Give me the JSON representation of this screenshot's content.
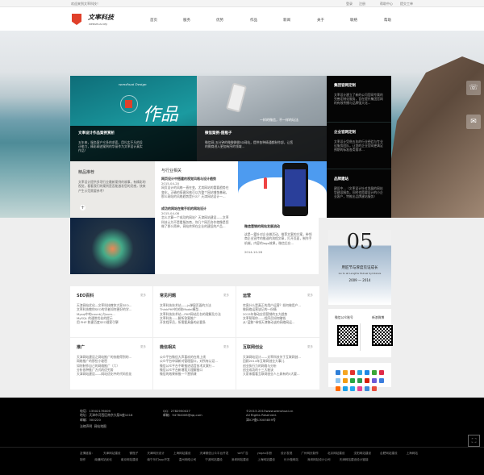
{
  "topbar": {
    "welcome": "欢迎来到文率科技！",
    "login": "登录",
    "register": "注册",
    "help": "帮助中心",
    "ticket": "提交工单"
  },
  "logo": {
    "name": "文率科技",
    "sub": "WENSHUAI KEJI"
  },
  "nav": [
    "首页",
    "服务",
    "优势",
    "作品",
    "新闻",
    "关于",
    "联络",
    "帮助"
  ],
  "hero": {
    "card1": {
      "brand": "wenshuai Design",
      "big": "作品",
      "title": "文率设计作品案例赏析",
      "desc": "五年来，服务客户众多的求索。用扎实不凡的设计能力，精彩阐述案例的华丽作为文率设计真实作品！"
    },
    "card2": {
      "tagline": "一样的微信，不一样的玩法",
      "title": "微信案例-甜瓶子",
      "desc": "微信网-五分钟的微微微微3D网站，提供各种精通都制作部，让您的微商进入更加有序的领域..."
    },
    "side": [
      {
        "title": "集团官网定制",
        "desc": "文率设计建立了新的公司官网专属的完善定制化服务，旨在提升集团官网的有效传播与品牌强大化..."
      },
      {
        "title": "企业官网定制",
        "desc": "文率设计凭借五年的行业经验与专业化服务团队，让您的企业官网更满足预期的标准各类需求..."
      },
      {
        "title": "品牌建站",
        "desc": "建设中...（文率设计针对发展的网站型建设服务，同时也简要设计的小企业客户，特推出品牌建站服务）"
      }
    ]
  },
  "feature": {
    "title": "精品推荐",
    "desc": "文率设计提供多项行业最新案例的故事，有精彩的视觉，看看我们的案例是否能激发您的灵感，快来产生示范需要参考！"
  },
  "industry": {
    "title": "与行业相关",
    "news": [
      {
        "title": "网页设计中搭建的视觉风格与设计趋势",
        "date": "2015-04-20",
        "desc": "网页设计的风格一直在变，尤其网站的重要趋势在变化，正确的搭建风格可以为整个网站铺垫基础，那么网站的风格趋势是什么？天津网站设计一..."
      },
      {
        "title": "成功的网站在做手机的网站设计",
        "date": "2015-04-08",
        "desc": "怎么才算一个成功的网站？天津网站建设——文率科技认为不是看服务商，你几个网页合作就像是您做了那么简单，网站终将在企业的建设的产品..."
      },
      {
        "title": "微信营销的网站发展流动",
        "date": "2014-10-28",
        "desc": "这是一篇针对企业做活动，推荐文案的方案，带领商企业宣传的推送的流程文章，打开页面，制作手机端，内容的logo效果，微信后台..."
      }
    ]
  },
  "grid": [
    {
      "title": "SEO百科",
      "more": "更多",
      "items": [
        "天津网站优化—文率科技教你大家SEO...",
        "文率科技教你SEO的学者如何更好的学...",
        "Mysql中的count()与sum...",
        "MySQL 的通常优化的提示",
        "用 PHP 和建百度SEO搜索引擎"
      ]
    },
    {
      "title": "常见问题",
      "more": "更多",
      "items": [
        "文率科技技术站——js弹窗页面的方法",
        "ThinkPHP的关联Model模型...",
        "文率科技技术站—PHP网站后台的理解及方法",
        "文率科技——解所答案推广",
        "开发程序员，所需要具备的必要条"
      ]
    },
    {
      "title": "运营",
      "more": "更多",
      "items": [
        "究竟什么是真正的用户运营？如何做用户...",
        "做网络运营该记的一份情",
        "2015年移动应用营销的五大趋势",
        "文率帮帮你——程序员如何赚钱",
        "从“蓝鲸”带领天津移动谈的网络网运..."
      ]
    },
    {
      "title": "推广",
      "more": "更多",
      "items": [
        "天津网站建设之网站推广的技能得到的...",
        "网络推广的那些小秘密",
        "如何制作自己的网络推广（六）",
        "分析各种推广方式的优劣势",
        "天津网站建设——网站优化中的代码优化"
      ]
    },
    {
      "title": "微信相关",
      "more": "更多",
      "items": [
        "公众平台微信大声喜欢的在线上线",
        "公众平台申请新对管理窗口，对所有认证...",
        "微信公众平台不断推进语音技术文案行...",
        "微信公众平台新增我大理解接口",
        "微信的效果新推一个营销课"
      ]
    },
    {
      "title": "互联网创业",
      "more": "更多",
      "items": [
        "天津网站设计——文率科技关于互联网创...",
        "回顾2014年互联网创业大事儿",
        "创业执行力的网络与分析",
        "创业成功的十三大秘诀",
        "大家来看看互联网创业人士具有的5大要..."
      ]
    }
  ],
  "promo": {
    "number": "05",
    "title": "用匠节与厚度见证成长",
    "sub": "Go to all Lengths Mutual Symbiosis",
    "years": "2009 — 2014"
  },
  "qr": {
    "wechat": "微信公众账号",
    "weibo": "新浪微博"
  },
  "share_colors": [
    "#2f7fd8",
    "#f5a623",
    "#e2322d",
    "#2fa6e0",
    "#1e88e5",
    "#3aa637",
    "#e02a48",
    "#8ec5f0",
    "#f39c12",
    "#27a844",
    "#2e9b4e",
    "#d81e06",
    "#6b5bd8",
    "#3b7ddd",
    "#ff6a00",
    "#1aa0e8",
    "#22a7f0",
    "#e84393",
    "#3d8bd9",
    "#e74c3c"
  ],
  "footer": {
    "phone": "电话：13502176009",
    "address": "地址：天津市河西区南京大厦B座1016",
    "zip": "邮编：300220",
    "legal": "法律声明",
    "sitemap": "网站地图",
    "qq": "QQ：2782950027",
    "email": "邮箱：94764006@qq.com",
    "copyright": "©2013-2015www.wenshuai.cn",
    "rights": "All Rights Reserved.",
    "icp": "津ICP备13005859号",
    "links_label": "友情链接：",
    "links": [
      "天津网站建设",
      "微瓶子",
      "天津网页设计",
      "上海网站建设",
      "天津微信公众平台开发",
      "wifi广告",
      "yagao手册",
      "设计发现",
      "广州网页制作",
      "北京网站建设",
      "沈阳网站建设",
      "合肥网站建设",
      "上海网站制作",
      "南通网站优化",
      "南京网站建设",
      "南宁乐们app开发",
      "温州网络公司",
      "宁波网站建设",
      "深圳网站建设",
      "上海网站建设",
      "长沙做网站",
      "深圳网站设计公司",
      "天津网站建设设计链接"
    ]
  }
}
